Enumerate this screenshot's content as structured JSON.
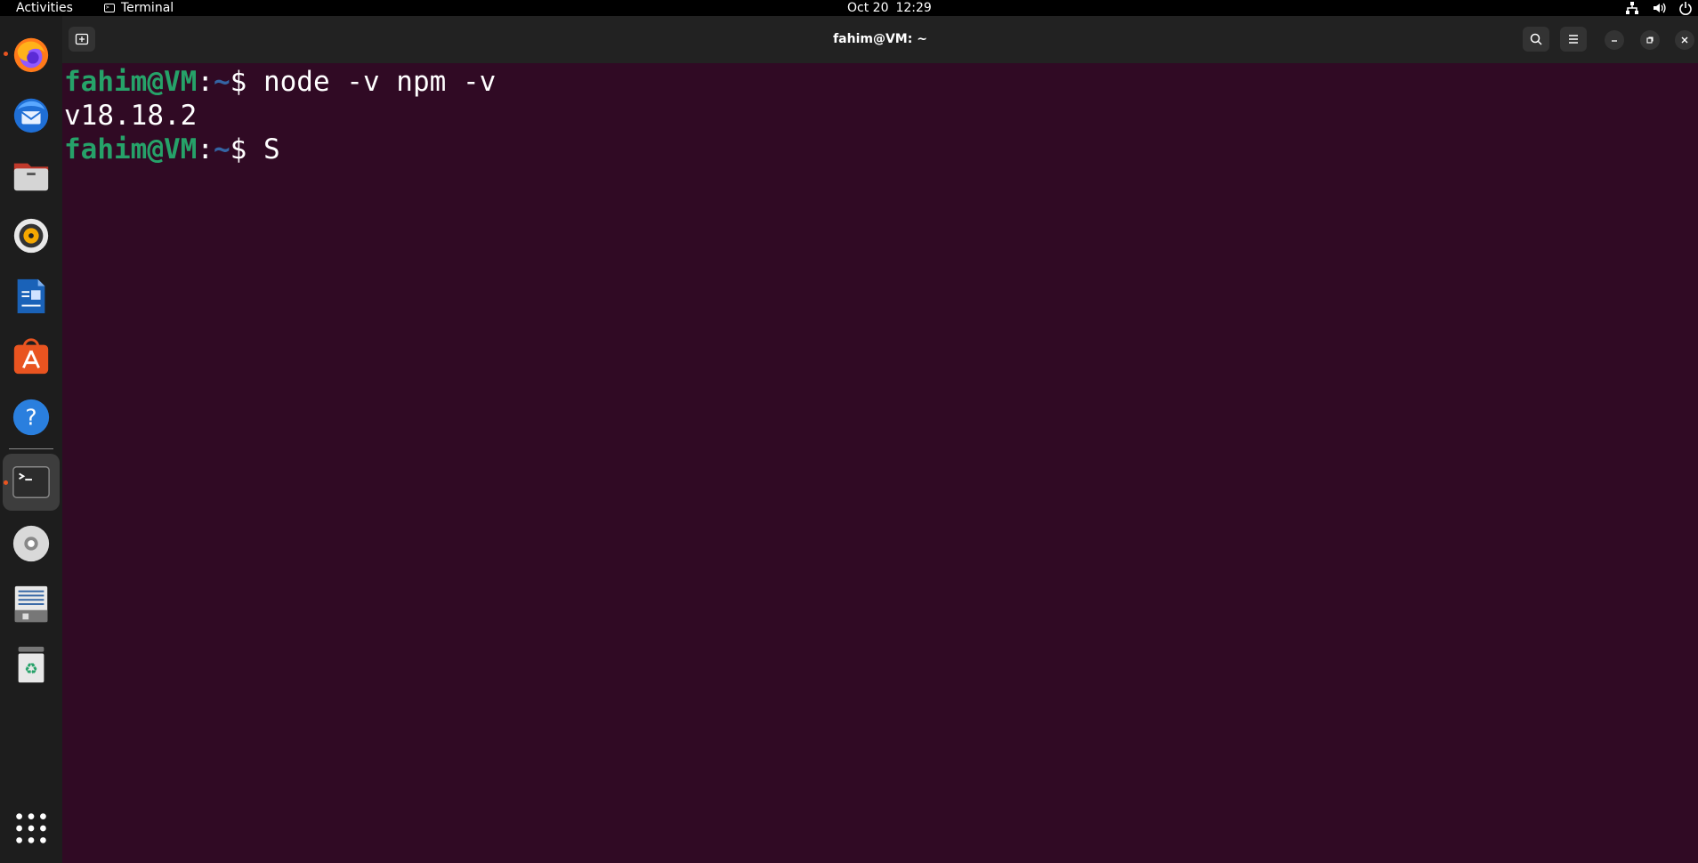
{
  "topbar": {
    "activities": "Activities",
    "app_name": "Terminal",
    "date": "Oct 20",
    "time": "12:29",
    "tray_icons": [
      "network-icon",
      "volume-icon",
      "power-icon"
    ]
  },
  "dock": {
    "items": [
      {
        "name": "firefox",
        "icon": "firefox-icon",
        "running": true
      },
      {
        "name": "thunderbird",
        "icon": "thunderbird-icon",
        "running": false
      },
      {
        "name": "files",
        "icon": "files-icon",
        "running": false
      },
      {
        "name": "rhythmbox",
        "icon": "rhythmbox-icon",
        "running": false
      },
      {
        "name": "libreoffice-writer",
        "icon": "writer-icon",
        "running": false
      },
      {
        "name": "app-center",
        "icon": "app-center-icon",
        "running": false
      },
      {
        "name": "help",
        "icon": "help-icon",
        "running": false
      },
      {
        "name": "terminal",
        "icon": "terminal-icon",
        "running": true,
        "active": true
      },
      {
        "name": "disc",
        "icon": "disc-icon",
        "running": false
      },
      {
        "name": "text-editor",
        "icon": "text-editor-icon",
        "running": false
      },
      {
        "name": "trash",
        "icon": "trash-icon",
        "running": false
      }
    ],
    "show_apps_icon": "app-grid-icon"
  },
  "window": {
    "title": "fahim@VM: ~",
    "new_tab_icon": "new-tab-icon",
    "search_icon": "search-icon",
    "menu_icon": "hamburger-menu-icon"
  },
  "terminal": {
    "lines": [
      {
        "user": "fahim@VM",
        "sep": ":",
        "path": "~",
        "prompt": "$ ",
        "command": "node -v npm -v"
      },
      {
        "output": "v18.18.2"
      },
      {
        "user": "fahim@VM",
        "sep": ":",
        "path": "~",
        "prompt": "$ ",
        "command": "S"
      }
    ]
  },
  "colors": {
    "terminal_bg": "#300a24",
    "prompt_user": "#26a269",
    "prompt_path": "#3465a4",
    "running_dot": "#e95420"
  }
}
